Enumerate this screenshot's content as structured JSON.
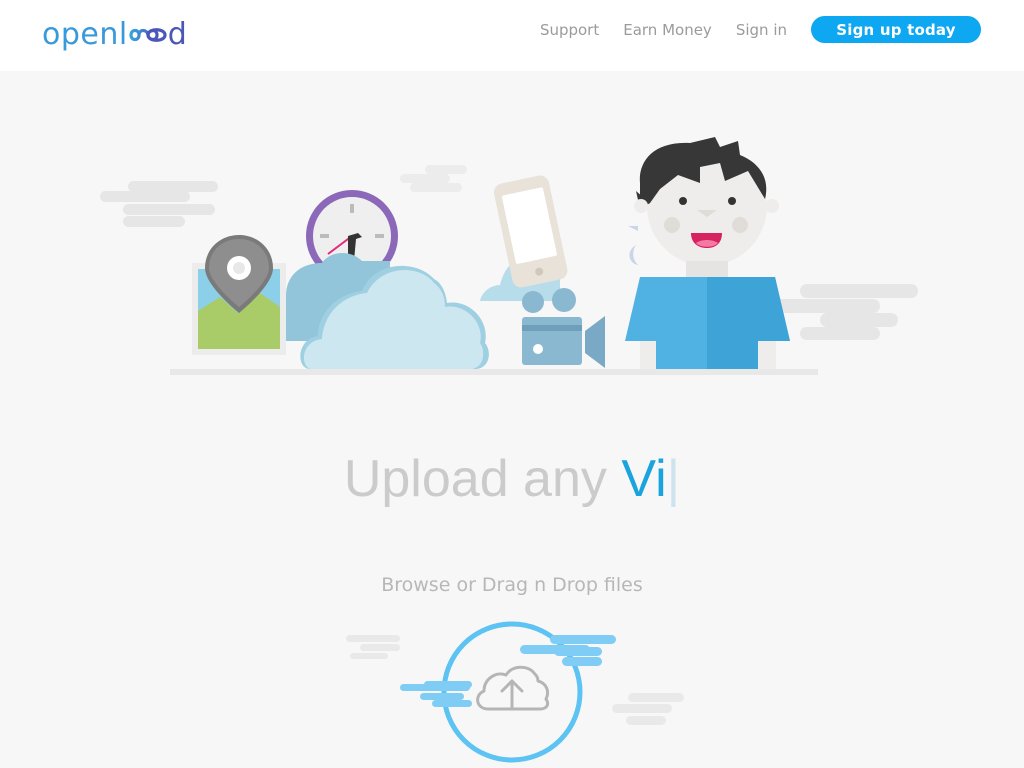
{
  "header": {
    "logo_left": "openl",
    "logo_right": "d",
    "nav": {
      "support": "Support",
      "earn_money": "Earn Money",
      "sign_in": "Sign in",
      "signup": "Sign up today"
    }
  },
  "hero": {
    "headline_static": "Upload any",
    "headline_typed": "Vi",
    "caret": "|",
    "subline": "Browse or Drag n Drop files"
  },
  "icons": {
    "upload": "cloud-upload-icon"
  },
  "colors": {
    "brand": "#3a9ad9",
    "accent": "#0ea7f1",
    "upload_ring": "#5cc3f3"
  }
}
